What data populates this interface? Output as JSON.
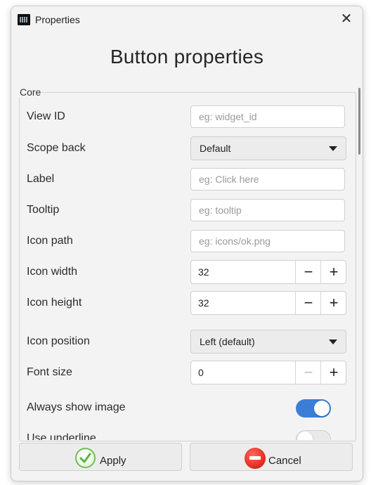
{
  "window": {
    "title": "Properties",
    "close_glyph": "✕"
  },
  "dialog": {
    "title": "Button properties"
  },
  "group": {
    "legend": "Core"
  },
  "fields": {
    "view_id": {
      "label": "View ID",
      "placeholder": "eg: widget_id"
    },
    "scope_back": {
      "label": "Scope back",
      "value": "Default"
    },
    "label": {
      "label": "Label",
      "placeholder": "eg: Click here"
    },
    "tooltip": {
      "label": "Tooltip",
      "placeholder": "eg: tooltip"
    },
    "icon_path": {
      "label": "Icon path",
      "placeholder": "eg: icons/ok.png"
    },
    "icon_width": {
      "label": "Icon width",
      "value": "32"
    },
    "icon_height": {
      "label": "Icon height",
      "value": "32"
    },
    "icon_position": {
      "label": "Icon position",
      "value": "Left (default)"
    },
    "font_size": {
      "label": "Font size",
      "value": "0"
    },
    "always_show_image": {
      "label": "Always show image",
      "state": "on"
    },
    "use_underline": {
      "label": "Use underline",
      "state": "off"
    }
  },
  "spinner_glyphs": {
    "minus": "−",
    "plus": "+"
  },
  "footer": {
    "apply_label": "Apply",
    "cancel_label": "Cancel"
  },
  "colors": {
    "accent": "#3b7ed8",
    "apply_green": "#6fbf57",
    "cancel_red": "#e0271b"
  },
  "icons": {
    "app": "app-icon",
    "close": "close-icon",
    "apply": "check-circle-icon",
    "cancel": "no-entry-icon",
    "dropdown": "caret-down-icon"
  }
}
